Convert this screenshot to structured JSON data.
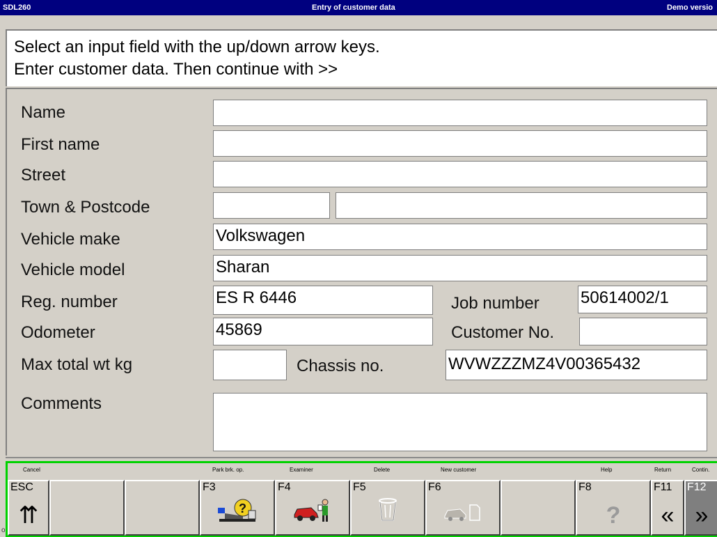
{
  "titlebar": {
    "app": "SDL260",
    "title": "Entry of customer data",
    "mode": "Demo versio"
  },
  "instructions": {
    "line1": "Select an input field with the up/down arrow keys.",
    "line2": "Enter customer data. Then continue with >>"
  },
  "form": {
    "name": {
      "label": "Name",
      "value": ""
    },
    "first_name": {
      "label": "First name",
      "value": ""
    },
    "street": {
      "label": "Street",
      "value": ""
    },
    "town": {
      "label": "Town & Postcode",
      "postcode": "",
      "town": ""
    },
    "make": {
      "label": "Vehicle make",
      "value": "Volkswagen"
    },
    "model": {
      "label": "Vehicle model",
      "value": "Sharan"
    },
    "reg": {
      "label": "Reg. number",
      "value": "ES R 6446"
    },
    "job": {
      "label": "Job number",
      "value": "50614002/1"
    },
    "odometer": {
      "label": "Odometer",
      "value": "45869"
    },
    "customer_no": {
      "label": "Customer No.",
      "value": ""
    },
    "max_wt": {
      "label": "Max total wt  kg",
      "value": ""
    },
    "chassis": {
      "label": "Chassis no.",
      "value": "WVWZZZMZ4V00365432"
    },
    "comments": {
      "label": "Comments",
      "value": ""
    }
  },
  "fkeys": {
    "esc": {
      "caption": "Cancel",
      "label": "ESC",
      "icon": "double-up-arrow-icon"
    },
    "f3": {
      "caption": "Park brk. op.",
      "label": "F3",
      "icon": "park-brake-help-icon"
    },
    "f4": {
      "caption": "Examiner",
      "label": "F4",
      "icon": "examiner-car-icon"
    },
    "f5": {
      "caption": "Delete",
      "label": "F5",
      "icon": "trash-bin-icon"
    },
    "f6": {
      "caption": "New customer",
      "label": "F6",
      "icon": "new-customer-car-icon"
    },
    "f8": {
      "caption": "Help",
      "label": "F8",
      "icon": "help-question-icon"
    },
    "f11": {
      "caption": "Return",
      "label": "F11",
      "icon": "double-left-arrow-icon"
    },
    "f12": {
      "caption": "Contin.",
      "label": "F12",
      "icon": "double-right-arrow-icon"
    }
  },
  "stray_text": "o",
  "colors": {
    "titlebar": "#00007f",
    "panel": "#d4d0c8",
    "fkey_border": "#00d200"
  }
}
